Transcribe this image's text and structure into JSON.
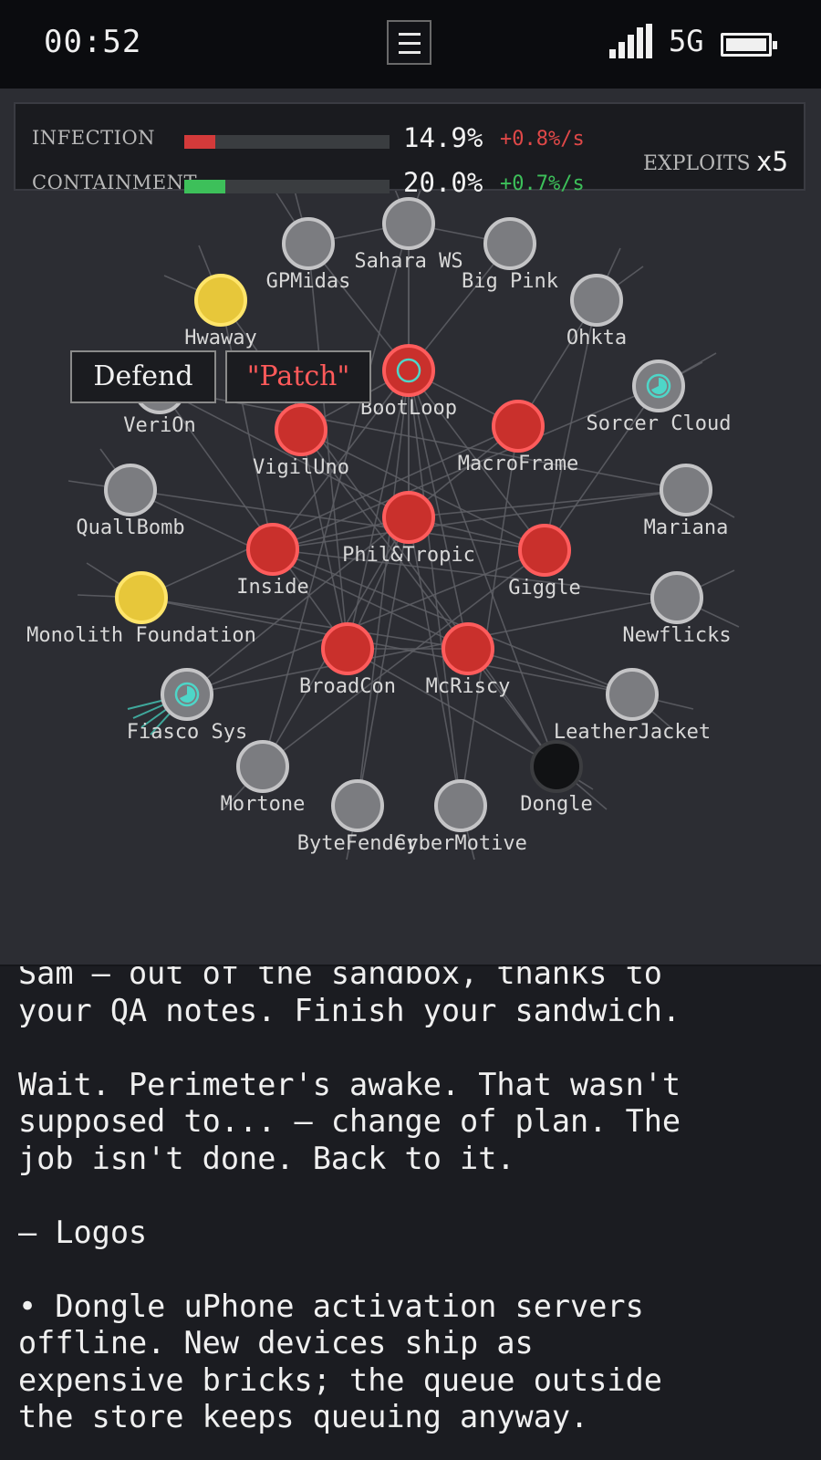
{
  "status_bar": {
    "time": "00:52",
    "network": "5G",
    "signal_icon": "signal-bars-icon",
    "battery_icon": "battery-full-icon",
    "menu_icon": "hamburger-menu-icon"
  },
  "hud": {
    "infection": {
      "label": "INFECTION",
      "value": "14.9%",
      "rate": "+0.8%/s",
      "fraction": 0.149,
      "color": "#d33a3a",
      "rate_color": "#e04848"
    },
    "containment": {
      "label": "CONTAINMENT",
      "value": "20.0%",
      "rate": "+0.7%/s",
      "fraction": 0.2,
      "color": "#3dc05a",
      "rate_color": "#3dc05a"
    },
    "exploits_label": "EXPLOITS",
    "exploits_count": "x5"
  },
  "popup": {
    "defend_label": "Defend",
    "patch_label": "\"Patch\""
  },
  "colors": {
    "infected": "#c9302c",
    "infected_ring": "#ff5c5c",
    "neutral": "#7b7c80",
    "neutral_ring": "#c4c4c6",
    "alert": "#e7c73a",
    "alert_ring": "#ffe56a",
    "offline": "#111214",
    "offline_ring": "#3c3d40",
    "scanner": "#4ed6c8"
  },
  "nodes": [
    {
      "id": "gpmidas",
      "name": "GPMidas",
      "state": "neutral"
    },
    {
      "id": "sahara",
      "name": "Sahara WS",
      "state": "neutral"
    },
    {
      "id": "bigpink",
      "name": "Big Pink",
      "state": "neutral"
    },
    {
      "id": "hwaway",
      "name": "Hwaway",
      "state": "alert"
    },
    {
      "id": "ohkta",
      "name": "Ohkta",
      "state": "neutral"
    },
    {
      "id": "verion",
      "name": "VeriOn",
      "state": "neutral"
    },
    {
      "id": "bootloop",
      "name": "BootLoop",
      "state": "infected",
      "selected": true
    },
    {
      "id": "sorcer",
      "name": "Sorcer Cloud",
      "state": "neutral",
      "scanning": true
    },
    {
      "id": "vigiluno",
      "name": "VigilUno",
      "state": "infected"
    },
    {
      "id": "macroframe",
      "name": "MacroFrame",
      "state": "infected"
    },
    {
      "id": "quallbomb",
      "name": "QuallBomb",
      "state": "neutral"
    },
    {
      "id": "mariana",
      "name": "Mariana",
      "state": "neutral"
    },
    {
      "id": "philtropic",
      "name": "Phil&Tropic",
      "state": "infected"
    },
    {
      "id": "inside",
      "name": "Inside",
      "state": "infected"
    },
    {
      "id": "giggle",
      "name": "Giggle",
      "state": "infected"
    },
    {
      "id": "monolith",
      "name": "Monolith Foundation",
      "state": "alert"
    },
    {
      "id": "newflicks",
      "name": "Newflicks",
      "state": "neutral"
    },
    {
      "id": "broadcon",
      "name": "BroadCon",
      "state": "infected"
    },
    {
      "id": "mcriscy",
      "name": "McRiscy",
      "state": "infected"
    },
    {
      "id": "fiasco",
      "name": "Fiasco Sys",
      "state": "neutral",
      "scanning": true
    },
    {
      "id": "leatherjacket",
      "name": "LeatherJacket",
      "state": "neutral"
    },
    {
      "id": "mortone",
      "name": "Mortone",
      "state": "neutral"
    },
    {
      "id": "dongle",
      "name": "Dongle",
      "state": "offline"
    },
    {
      "id": "bytefender",
      "name": "ByteFender",
      "state": "neutral"
    },
    {
      "id": "cybermotive",
      "name": "CyberMotive",
      "state": "neutral"
    }
  ],
  "story": {
    "text": "Sam — out of the sandbox, thanks to\nyour QA notes. Finish your sandwich.\n\nWait. Perimeter's awake. That wasn't\nsupposed to... — change of plan. The\njob isn't done. Back to it.\n\n— Logos\n\n• Dongle uPhone activation servers\noffline. New devices ship as\nexpensive bricks; the queue outside\nthe store keeps queuing anyway."
  }
}
